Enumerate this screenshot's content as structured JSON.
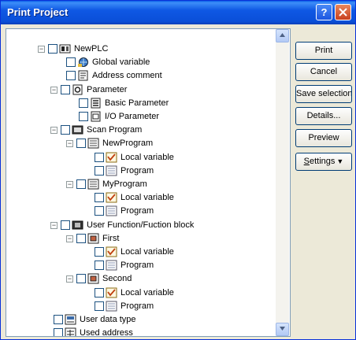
{
  "window": {
    "title": "Print Project",
    "help_label": "?",
    "accent": "#0a4fd8"
  },
  "tree": {
    "items": [
      {
        "label": "NewPLC",
        "icon": "plc-icon",
        "expander": "minus"
      },
      {
        "label": "Global variable",
        "icon": "global-variable-icon",
        "expander": "none"
      },
      {
        "label": "Address comment",
        "icon": "address-comment-icon",
        "expander": "none"
      },
      {
        "label": "Parameter",
        "icon": "parameter-icon",
        "expander": "minus"
      },
      {
        "label": "Basic Parameter",
        "icon": "basic-parameter-icon",
        "expander": "none"
      },
      {
        "label": "I/O Parameter",
        "icon": "io-parameter-icon",
        "expander": "none"
      },
      {
        "label": "Scan Program",
        "icon": "scan-program-icon",
        "expander": "minus"
      },
      {
        "label": "NewProgram",
        "icon": "program-folder-icon",
        "expander": "minus"
      },
      {
        "label": "Local variable",
        "icon": "local-variable-icon",
        "expander": "none"
      },
      {
        "label": "Program",
        "icon": "program-icon",
        "expander": "none"
      },
      {
        "label": "MyProgram",
        "icon": "program-folder-icon",
        "expander": "minus"
      },
      {
        "label": "Local variable",
        "icon": "local-variable-icon",
        "expander": "none"
      },
      {
        "label": "Program",
        "icon": "program-icon",
        "expander": "none"
      },
      {
        "label": "User Function/Fuction block",
        "icon": "user-function-icon",
        "expander": "minus"
      },
      {
        "label": "First",
        "icon": "function-block-icon",
        "expander": "minus"
      },
      {
        "label": "Local variable",
        "icon": "local-variable-icon",
        "expander": "none"
      },
      {
        "label": "Program",
        "icon": "program-icon",
        "expander": "none"
      },
      {
        "label": "Second",
        "icon": "function-block-icon",
        "expander": "minus"
      },
      {
        "label": "Local variable",
        "icon": "local-variable-icon",
        "expander": "none"
      },
      {
        "label": "Program",
        "icon": "program-icon",
        "expander": "none"
      },
      {
        "label": "User data type",
        "icon": "user-data-type-icon",
        "expander": "none"
      },
      {
        "label": "Used address",
        "icon": "used-address-icon",
        "expander": "none"
      }
    ]
  },
  "buttons": {
    "print": "Print",
    "cancel": "Cancel",
    "save_selection": "Save selection",
    "details": "Details...",
    "preview": "Preview",
    "settings_accel": "S",
    "settings_rest": "ettings"
  }
}
